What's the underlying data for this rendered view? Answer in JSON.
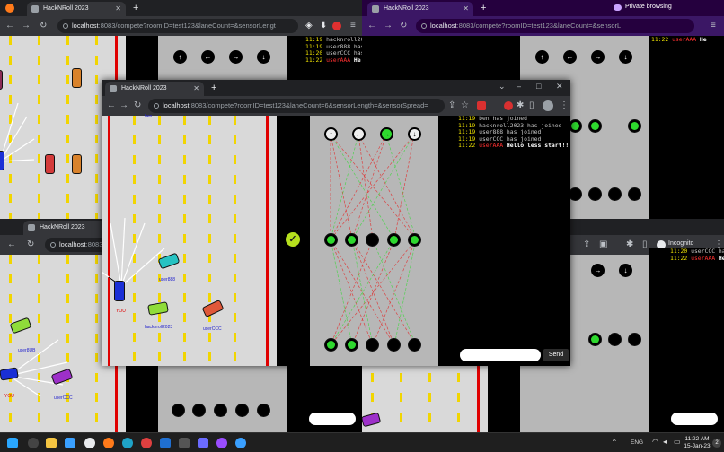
{
  "tl": {
    "tab_title": "HackNRoll 2023",
    "url_host": "localhost",
    "url_rest": ":8083/compete?roomID=test123&laneCount=&sensorLengt",
    "chat": [
      {
        "time": "11:19",
        "text": "hacknroll202"
      },
      {
        "time": "11:19",
        "text": "user888 has j"
      },
      {
        "time": "11:20",
        "text": "userCCC has j"
      },
      {
        "time": "11:22",
        "user": "userAAA",
        "msg": "He"
      }
    ]
  },
  "tr": {
    "tab_title": "HackNRoll 2023",
    "private_label": "Private browsing",
    "url_host": "localhost",
    "url_rest": ":8083/compete?roomID=test123&laneCount=&sensorL",
    "chat": [
      {
        "time": "11:22",
        "user": "userAAA",
        "msg": "He"
      }
    ]
  },
  "bl": {
    "tab_title": "HackNRoll 2023",
    "url_host": "localhost",
    "url_rest": ":8083/c",
    "car_labels": [
      "user8UB",
      "YOU",
      "userCCC"
    ]
  },
  "br": {
    "incognito_label": "Incognito",
    "chat": [
      {
        "time": "11:20",
        "text": "userCCC has"
      },
      {
        "time": "11:22",
        "user": "userAAA",
        "msg": "He"
      }
    ]
  },
  "main": {
    "tab_title": "HackNRoll 2023",
    "url_host": "localhost",
    "url_rest": ":8083/compete?roomID=test123&laneCount=6&sensorLength=&sensorSpread=",
    "car_labels": {
      "top": "ben",
      "you": "YOU",
      "user888": "user888",
      "hacknroll": "hacknroll2023",
      "userccc": "userCCC"
    },
    "chat": [
      {
        "time": "11:19",
        "text": "ben has joined"
      },
      {
        "time": "11:19",
        "text": "hacknroll2023 has joined"
      },
      {
        "time": "11:19",
        "text": "user888 has joined"
      },
      {
        "time": "11:19",
        "text": "userCCC has joined"
      }
    ],
    "chat_last": {
      "time": "11:22",
      "user": "userAAA",
      "msg": "Hello less start!!"
    },
    "send_label": "Send",
    "check_symbol": "✓"
  },
  "taskbar": {
    "lang": "ENG",
    "time": "11:22 AM",
    "date": "15-Jan-23",
    "badge": "2"
  }
}
